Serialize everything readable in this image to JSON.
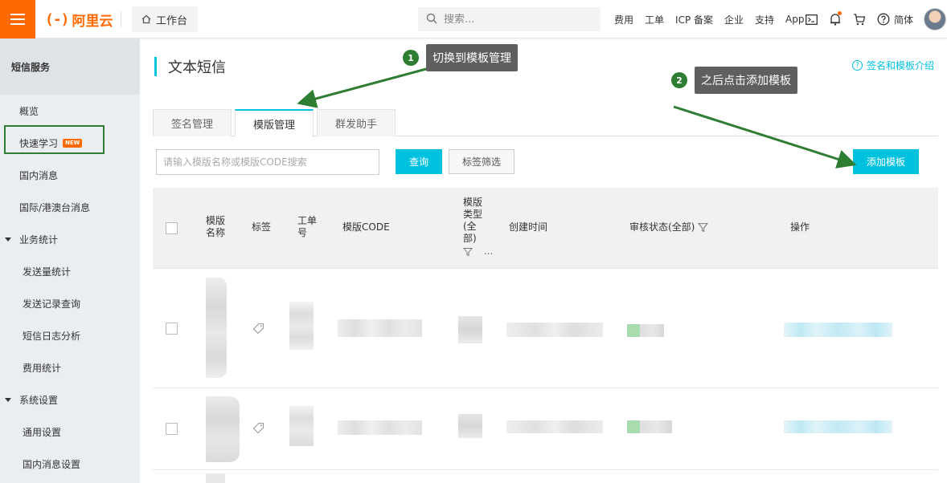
{
  "topbar": {
    "logo_mark": "(-)",
    "logo_text": "阿里云",
    "workbench": "工作台",
    "search_placeholder": "搜索...",
    "nav": [
      "费用",
      "工单",
      "ICP 备案",
      "企业",
      "支持",
      "App"
    ],
    "lang": "简体"
  },
  "sidebar": {
    "title": "短信服务",
    "items": {
      "overview": "概览",
      "quickstart": "快速学习",
      "quickstart_badge": "NEW",
      "domestic": "国内消息",
      "international": "国际/港澳台消息",
      "stats_group": "业务统计",
      "send_stats": "发送量统计",
      "send_records": "发送记录查询",
      "log_analysis": "短信日志分析",
      "cost_stats": "费用统计",
      "settings_group": "系统设置",
      "general_settings": "通用设置",
      "domestic_settings": "国内消息设置"
    }
  },
  "main": {
    "title": "文本短信",
    "help_link": "签名和模板介绍",
    "help_icon_glyph": "?",
    "tabs": [
      "签名管理",
      "模版管理",
      "群发助手"
    ],
    "search_placeholder": "请输入模版名称或模版CODE搜索",
    "query_button": "查询",
    "filter_button": "标签筛选",
    "add_button": "添加模板"
  },
  "table": {
    "headers": {
      "name_1": "模版",
      "name_2": "名称",
      "tag": "标签",
      "ticket_1": "工单",
      "ticket_2": "号",
      "code": "模版CODE",
      "type_1": "模版",
      "type_2": "类型",
      "type_3": "(全",
      "type_4": "部)",
      "type_more": "...",
      "created": "创建时间",
      "status": "审核状态(全部)",
      "actions": "操作"
    }
  },
  "annotations": {
    "step1_num": "1",
    "step1_text": "切换到模板管理",
    "step2_num": "2",
    "step2_text": "之后点击添加模板",
    "color": "#2e7d32"
  },
  "colors": {
    "brand": "#ff6a00",
    "accent": "#00c1de"
  }
}
